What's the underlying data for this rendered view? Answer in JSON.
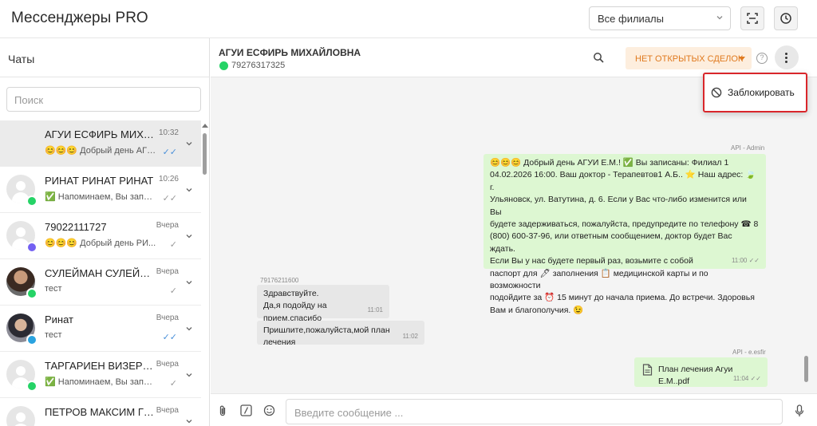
{
  "app": {
    "title": "Мессенджеры PRO"
  },
  "header": {
    "branch_select": "Все филиалы"
  },
  "left": {
    "title": "Чаты",
    "search_placeholder": "Поиск",
    "chats": [
      {
        "name": "АГУИ ЕСФИРЬ МИХАЙЛО...",
        "time": "10:32",
        "preview": "😊😊😊 Добрый день АГУИ ...",
        "status": "✓✓",
        "channel": "whatsapp-icon"
      },
      {
        "name": "РИНАТ РИНАТ РИНАТ",
        "time": "10:26",
        "preview": "✅ Напоминаем, Вы запис...",
        "status": "✓✓",
        "channel": "whatsapp-icon"
      },
      {
        "name": "79022111727",
        "time": "Вчера",
        "preview": "😊😊😊 Добрый день РИ...",
        "status": "✓",
        "channel": "viber-icon"
      },
      {
        "name": "СУЛЕЙМАН СУЛЕЙМАН...",
        "time": "Вчера",
        "preview": "тест",
        "status": "✓",
        "channel": "whatsapp-icon"
      },
      {
        "name": "Ринат",
        "time": "Вчера",
        "preview": "тест",
        "status": "✓✓",
        "channel": "telegram-icon"
      },
      {
        "name": "ТАРГАРИЕН ВИЗЕРИС Э...",
        "time": "Вчера",
        "preview": "✅ Напоминаем, Вы запис...",
        "status": "✓",
        "channel": "whatsapp-icon"
      },
      {
        "name": "ПЕТРОВ МАКСИМ ГРИГ...",
        "time": "Вчера",
        "preview": "",
        "status": "",
        "channel": "telegram-icon"
      }
    ]
  },
  "chat": {
    "contact_name": "АГУИ ЕСФИРЬ МИХАЙЛОВНА",
    "contact_phone": "79276317325",
    "deals_button": "НЕТ ОТКРЫТЫХ СДЕЛОК",
    "menu": {
      "block_label": "Заблокировать"
    },
    "messages": {
      "m1_sender": "API - Admin",
      "m1_lines": [
        "😊😊😊 Добрый день АГУИ Е.М.! ✅ Вы записаны: Филиал 1",
        "04.02.2026 16:00. Ваш доктор - Терапевтов1 А.Б.. ⭐ Наш адрес: 🍃 г.",
        "Ульяновск, ул. Ватутина, д. 6. Если у Вас что-либо изменится или Вы",
        "будете задерживаться, пожалуйста, предупредите по телефону ☎ 8",
        "(800) 600-37-96, или ответным сообщением, доктор будет Вас ждать.",
        "Если Вы у нас будете первый раз, возьмите с собой",
        "паспорт для 🖊 заполнения 📋 медицинской карты и по возможности",
        "подойдите за ⏰ 15 минут до начала приема. До встречи. Здоровья",
        "Вам и благополучия. 😉"
      ],
      "m1_time": "11:00 ✓✓",
      "m2_sender": "79176211600",
      "m2_line1": "Здравствуйте.",
      "m2_line2": "Да,я подойду на прием,спасибо",
      "m2_time": "11:01",
      "m3_text": "Пришлите,пожалуйста,мой план лечения",
      "m3_time": "11:02",
      "m4_sender": "API - e.esfir",
      "m4_file": "План лечения Агуи Е.М..pdf",
      "m4_time": "11:04 ✓✓"
    },
    "composer_placeholder": "Введите сообщение ..."
  }
}
